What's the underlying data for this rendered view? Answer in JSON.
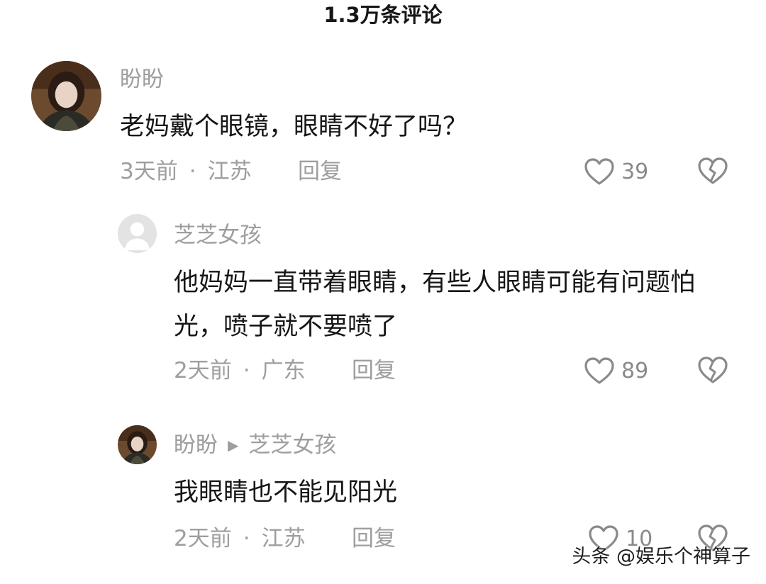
{
  "header": {
    "title": "1.3万条评论"
  },
  "comments": [
    {
      "author": "盼盼",
      "text": "老妈戴个眼镜，眼睛不好了吗？",
      "time": "3天前",
      "location": "江苏",
      "reply_label": "回复",
      "likes": "39"
    },
    {
      "author": "芝芝女孩",
      "text": "他妈妈一直带着眼睛，有些人眼睛可能有问题怕光，喷子就不要喷了",
      "time": "2天前",
      "location": "广东",
      "reply_label": "回复",
      "likes": "89"
    },
    {
      "author": "盼盼",
      "reply_to": "芝芝女孩",
      "text": "我眼睛也不能见阳光",
      "time": "2天前",
      "location": "江苏",
      "reply_label": "回复",
      "likes": "10"
    }
  ],
  "watermark": "头条 @娱乐个神算子",
  "icons": {
    "like": "heart-outline-icon",
    "dislike": "broken-heart-icon",
    "reply_arrow": "play-triangle-icon"
  },
  "colors": {
    "text_primary": "#161616",
    "text_secondary": "#9e9e9e",
    "background": "#ffffff"
  }
}
